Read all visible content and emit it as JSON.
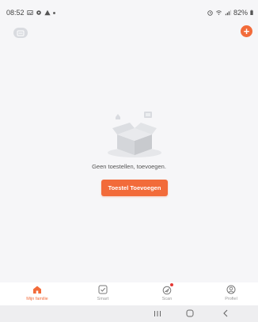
{
  "status_bar": {
    "time": "08:52",
    "battery": "82%"
  },
  "empty_state": {
    "message": "Geen toestellen, toevoegen.",
    "button_label": "Toestel Toevoegen"
  },
  "tabs": [
    {
      "label": "Mijn familie",
      "icon": "home-icon",
      "active": true
    },
    {
      "label": "Smart",
      "icon": "smart-icon",
      "active": false
    },
    {
      "label": "Scan",
      "icon": "scan-icon",
      "active": false
    },
    {
      "label": "Profiel",
      "icon": "profile-icon",
      "active": false
    }
  ],
  "colors": {
    "accent": "#f26b3a",
    "background": "#f6f6f8",
    "tab_inactive": "#9a9a9a",
    "badge": "#e53935"
  }
}
